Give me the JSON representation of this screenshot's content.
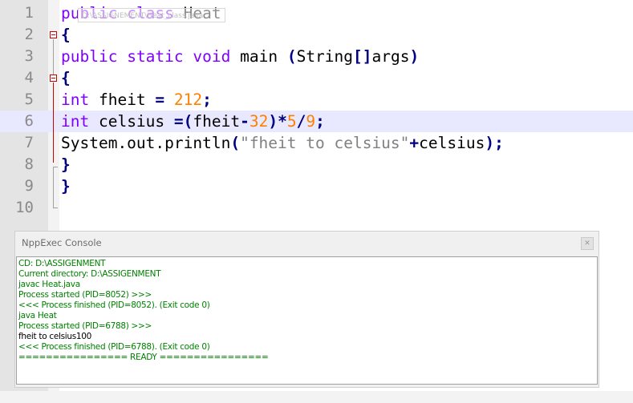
{
  "editor": {
    "lines": [
      {
        "num": "1",
        "parts": [
          {
            "t": "public",
            "c": "kw"
          },
          {
            "t": " ",
            "c": ""
          },
          {
            "t": "class",
            "c": "kw"
          },
          {
            "t": " Heat",
            "c": ""
          }
        ]
      },
      {
        "num": "2",
        "parts": [
          {
            "t": "{",
            "c": "op"
          }
        ]
      },
      {
        "num": "3",
        "parts": [
          {
            "t": "public",
            "c": "kw"
          },
          {
            "t": " ",
            "c": ""
          },
          {
            "t": "static",
            "c": "kw"
          },
          {
            "t": " ",
            "c": ""
          },
          {
            "t": "void",
            "c": "kw"
          },
          {
            "t": " main ",
            "c": ""
          },
          {
            "t": "(",
            "c": "op"
          },
          {
            "t": "String",
            "c": ""
          },
          {
            "t": "[]",
            "c": "op"
          },
          {
            "t": "args",
            "c": ""
          },
          {
            "t": ")",
            "c": "op"
          }
        ]
      },
      {
        "num": "4",
        "parts": [
          {
            "t": "{",
            "c": "op"
          }
        ]
      },
      {
        "num": "5",
        "parts": [
          {
            "t": "int",
            "c": "ty"
          },
          {
            "t": " fheit ",
            "c": ""
          },
          {
            "t": "=",
            "c": "op"
          },
          {
            "t": " ",
            "c": ""
          },
          {
            "t": "212",
            "c": "num"
          },
          {
            "t": ";",
            "c": "op"
          }
        ]
      },
      {
        "num": "6",
        "parts": [
          {
            "t": "int",
            "c": "ty"
          },
          {
            "t": " celsius ",
            "c": ""
          },
          {
            "t": "=(",
            "c": "op"
          },
          {
            "t": "fheit",
            "c": ""
          },
          {
            "t": "-",
            "c": "op"
          },
          {
            "t": "32",
            "c": "num"
          },
          {
            "t": ")*",
            "c": "op"
          },
          {
            "t": "5",
            "c": "num"
          },
          {
            "t": "/",
            "c": "op"
          },
          {
            "t": "9",
            "c": "num"
          },
          {
            "t": ";",
            "c": "op"
          }
        ]
      },
      {
        "num": "7",
        "parts": [
          {
            "t": "System.out.println",
            "c": ""
          },
          {
            "t": "(",
            "c": "op"
          },
          {
            "t": "\"fheit to celsius\"",
            "c": "str"
          },
          {
            "t": "+",
            "c": "op"
          },
          {
            "t": "celsius",
            "c": ""
          },
          {
            "t": ");",
            "c": "op"
          }
        ]
      },
      {
        "num": "8",
        "parts": [
          {
            "t": "}",
            "c": "op"
          }
        ]
      },
      {
        "num": "9",
        "parts": [
          {
            "t": "}",
            "c": "op"
          }
        ]
      },
      {
        "num": "10",
        "parts": []
      }
    ],
    "current_line": 6,
    "tooltip": "D:\\ASSIGNEMENT\\Heat_class.java"
  },
  "console": {
    "title": "NppExec Console",
    "close_icon": "close-icon",
    "lines": [
      {
        "text": "CD: D:\\ASSIGENMENT",
        "color": "green"
      },
      {
        "text": "Current directory: D:\\ASSIGENMENT",
        "color": "green"
      },
      {
        "text": "javac Heat.java",
        "color": "green"
      },
      {
        "text": "Process started (PID=8052) >>>",
        "color": "green"
      },
      {
        "text": "<<< Process finished (PID=8052). (Exit code 0)",
        "color": "green"
      },
      {
        "text": "java Heat",
        "color": "green"
      },
      {
        "text": "Process started (PID=6788) >>>",
        "color": "green"
      },
      {
        "text": "fheit to celsius100",
        "color": "black"
      },
      {
        "text": "<<< Process finished (PID=6788). (Exit code 0)",
        "color": "green"
      },
      {
        "text": "================ READY ================",
        "color": "green"
      }
    ]
  },
  "colors": {
    "keyword": "#8000ff",
    "number": "#ff8000",
    "operator": "#000080",
    "string": "#808080",
    "current_line_bg": "#e8e8ff",
    "console_text": "#008000"
  }
}
